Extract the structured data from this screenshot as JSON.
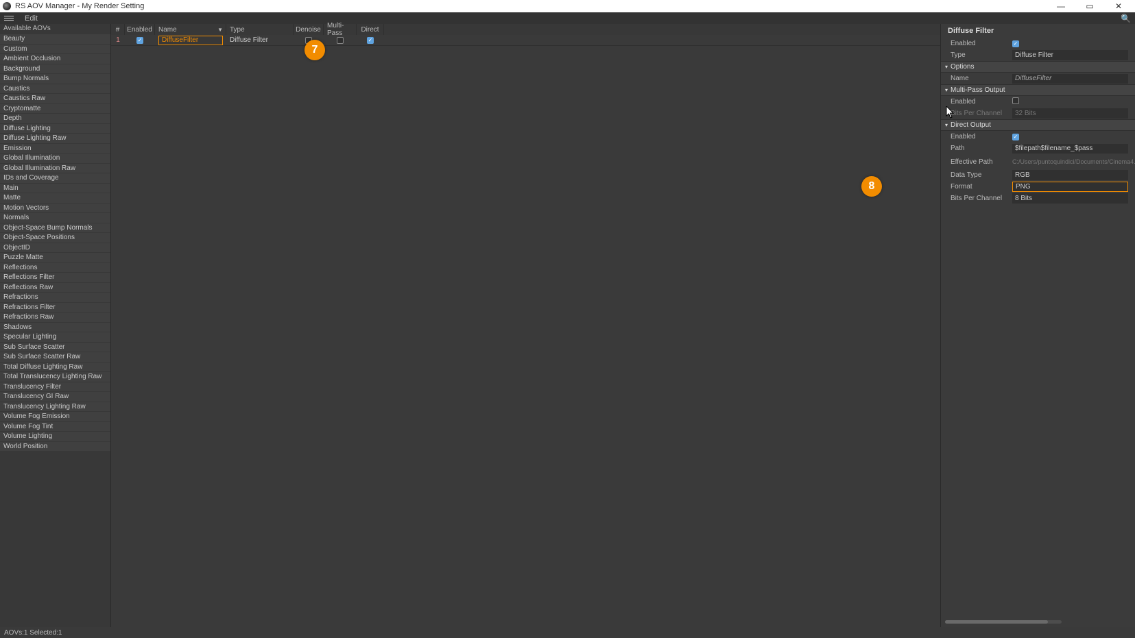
{
  "window": {
    "title": "RS AOV Manager - My Render Setting",
    "minimize": "—",
    "maximize": "▭",
    "close": "✕"
  },
  "menu": {
    "edit": "Edit"
  },
  "left": {
    "header": "Available AOVs",
    "items": [
      "Beauty",
      "Custom",
      "Ambient Occlusion",
      "Background",
      "Bump Normals",
      "Caustics",
      "Caustics Raw",
      "Cryptomatte",
      "Depth",
      "Diffuse Lighting",
      "Diffuse Lighting Raw",
      "Emission",
      "Global Illumination",
      "Global Illumination Raw",
      "IDs and Coverage",
      "Main",
      "Matte",
      "Motion Vectors",
      "Normals",
      "Object-Space Bump Normals",
      "Object-Space Positions",
      "ObjectID",
      "Puzzle Matte",
      "Reflections",
      "Reflections Filter",
      "Reflections Raw",
      "Refractions",
      "Refractions Filter",
      "Refractions Raw",
      "Shadows",
      "Specular Lighting",
      "Sub Surface Scatter",
      "Sub Surface Scatter Raw",
      "Total Diffuse Lighting Raw",
      "Total Translucency Lighting Raw",
      "Translucency Filter",
      "Translucency GI Raw",
      "Translucency Lighting Raw",
      "Volume Fog Emission",
      "Volume Fog Tint",
      "Volume Lighting",
      "World Position"
    ]
  },
  "table": {
    "headers": {
      "num": "#",
      "enabled": "Enabled",
      "name": "Name",
      "type": "Type",
      "denoise": "Denoise",
      "multipass": "Multi-Pass",
      "direct": "Direct",
      "sort": "▼"
    },
    "row": {
      "num": "1",
      "name": "DiffuseFilter",
      "type": "Diffuse Filter"
    }
  },
  "right": {
    "title": "Diffuse Filter",
    "enabled_label": "Enabled",
    "type_label": "Type",
    "type_value": "Diffuse Filter",
    "options_section": "Options",
    "name_label": "Name",
    "name_value": "DiffuseFilter",
    "multipass_section": "Multi-Pass Output",
    "mp_enabled_label": "Enabled",
    "mp_bpc_label": "Bits Per Channel",
    "mp_bpc_value": "32 Bits",
    "direct_section": "Direct Output",
    "do_enabled_label": "Enabled",
    "do_path_label": "Path",
    "do_path_value": "$filepath$filename_$pass",
    "do_effpath_label": "Effective Path",
    "do_effpath_value": "C:/Users/puntoquindici/Documents/Cinema4...",
    "do_datatype_label": "Data Type",
    "do_datatype_value": "RGB",
    "do_format_label": "Format",
    "do_format_value": "PNG",
    "do_bpc_label": "Bits Per Channel",
    "do_bpc_value": "8 Bits"
  },
  "badges": {
    "b7": "7",
    "b8": "8"
  },
  "status": "AOVs:1 Selected:1"
}
